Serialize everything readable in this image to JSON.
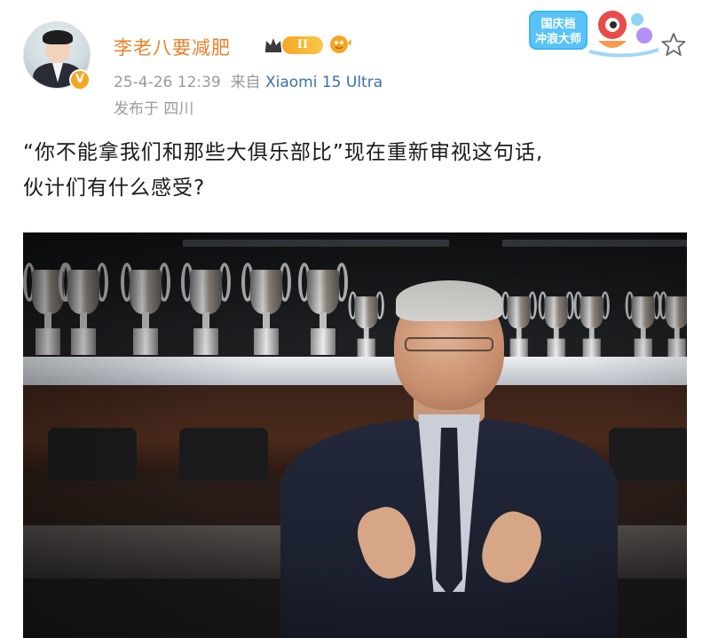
{
  "post": {
    "author": {
      "username": "李老八要减肥",
      "level_badge": "II",
      "verified": true
    },
    "meta": {
      "timestamp": "25-4-26 12:39",
      "source_prefix": "来自",
      "device": "Xiaomi 15 Ultra",
      "location": "发布于 四川"
    },
    "sticker_text": "国庆档冲浪大师",
    "content": {
      "line1": "“你不能拿我们和那些大俱乐部比”现在重新审视这句话,",
      "line2": "伙计们有什么感受?"
    },
    "icons": {
      "crown": "crown-icon",
      "bubble": "bubble-icon",
      "star": "star-icon",
      "verified": "verified-badge-icon"
    },
    "colors": {
      "username": "#e8812b",
      "device_link": "#3d6fa6",
      "meta": "#9a9a9a",
      "badge": "#f5a623"
    }
  }
}
